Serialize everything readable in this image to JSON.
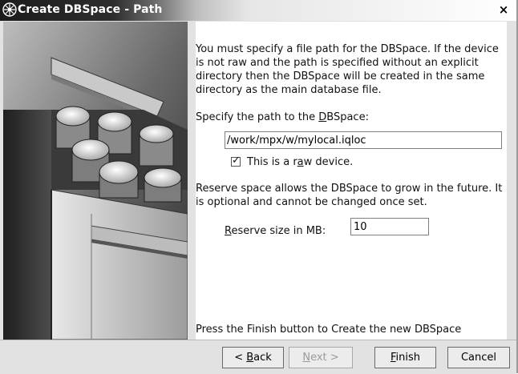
{
  "window": {
    "title": "Create DBSpace - Path",
    "close_glyph": "×",
    "icon": "dbspace-app-icon"
  },
  "intro_text": "You must specify a file path for the DBSpace.  If the device is not raw and the path is specified without an explicit directory then the DBSpace will be created in the same directory as the main database file.",
  "path": {
    "label_prefix": "Specify the path to the ",
    "label_accel": "D",
    "label_suffix": "BSpace:",
    "value": "/work/mpx/w/mylocal.iqloc"
  },
  "raw_device": {
    "checked": true,
    "check_glyph": "✓",
    "label_prefix": "This is a r",
    "label_accel": "a",
    "label_suffix": "w device."
  },
  "reserve_text": "Reserve space allows the DBSpace to grow in the future.  It is optional and cannot be changed once set.",
  "reserve": {
    "label_accel": "R",
    "label_suffix": "eserve size in MB:",
    "value": "10"
  },
  "finish_text": "Press the Finish button to Create the new DBSpace",
  "buttons": {
    "back": {
      "prefix": "< ",
      "accel": "B",
      "suffix": "ack"
    },
    "next": {
      "accel": "N",
      "suffix": "ext >"
    },
    "finish": {
      "accel": "F",
      "suffix": "inish"
    },
    "cancel": "Cancel"
  },
  "colors": {
    "titlebar_dark": "#1b1b1b",
    "panel_bg": "#e2e2e2",
    "content_bg": "#ffffff"
  }
}
